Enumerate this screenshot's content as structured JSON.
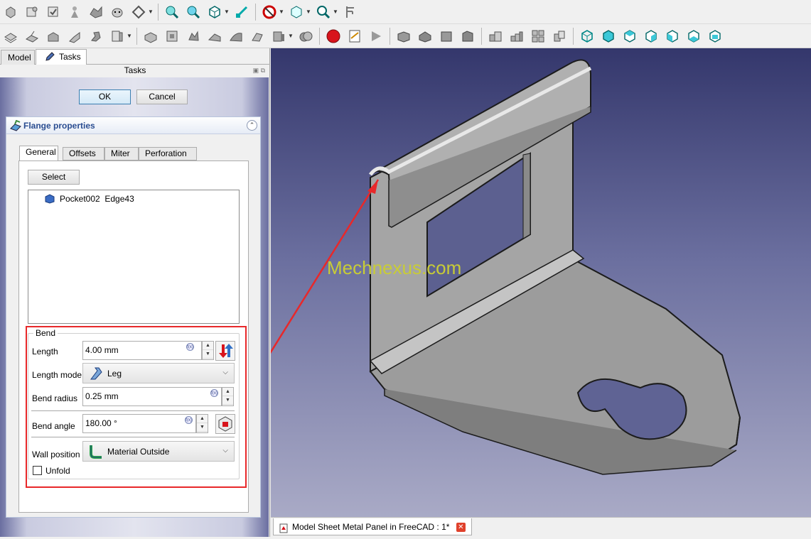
{
  "toolbar_row1": [
    "part-design-icon",
    "sketch-icon",
    "sketch-validate-icon",
    "robot-icon",
    "part-icon",
    "cow-icon",
    "draft-icon",
    "zoom-fit-icon",
    "zoom-select-icon",
    "axo-view-icon",
    "measure-icon",
    "draw-style-icon",
    "box-view-icon",
    "zoom-box-icon",
    "caliper-icon"
  ],
  "toolbar_row2": [
    "sheet-metal-icon",
    "wall-icon",
    "extend-icon",
    "fold-icon",
    "relief-icon",
    "corner-icon",
    "unfold-icon",
    "sketch-on-face-icon",
    "punch-icon",
    "hole-icon",
    "solid-icon",
    "bend-icon",
    "boolean-icon",
    "record-macro-icon",
    "edit-macro-icon",
    "play-macro-icon",
    "front-view-icon",
    "top-view-icon",
    "right-view-icon",
    "rear-view-icon",
    "stack-icon",
    "view-cube-icon"
  ],
  "panel": {
    "tabs": [
      {
        "label": "Model"
      },
      {
        "label": "Tasks"
      }
    ],
    "header": "Tasks",
    "ok_label": "OK",
    "cancel_label": "Cancel"
  },
  "flange": {
    "title": "Flange properties",
    "tabs": [
      "General",
      "Offsets",
      "Miter",
      "Perforation"
    ],
    "select_label": "Select",
    "selection": "Pocket002  Edge43",
    "bend": {
      "group_label": "Bend",
      "length_label": "Length",
      "length_value": "4.00 mm",
      "length_mode_label": "Length mode",
      "length_mode_value": "Leg",
      "radius_label": "Bend radius",
      "radius_value": "0.25 mm",
      "angle_label": "Bend angle",
      "angle_value": "180.00 °",
      "wall_label": "Wall position",
      "wall_value": "Material Outside",
      "unfold_label": "Unfold",
      "unfold_checked": false
    }
  },
  "view": {
    "watermark": "Mechnexus.com",
    "doc_tab": "Model Sheet Metal Panel in FreeCAD : 1*"
  },
  "colors": {
    "annotation": "#e8282a",
    "bg_top": "#34376c",
    "bg_bottom": "#a9aac6",
    "part": "#9c9c9c"
  }
}
